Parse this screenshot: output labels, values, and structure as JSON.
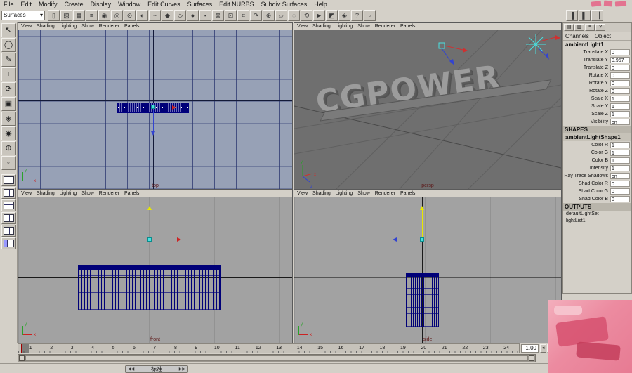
{
  "menubar": {
    "items": [
      "File",
      "Edit",
      "Modify",
      "Create",
      "Display",
      "Window",
      "Edit Curves",
      "Surfaces",
      "Edit NURBS",
      "Subdiv Surfaces",
      "Help"
    ]
  },
  "shelf": {
    "mode_selector": "Surfaces",
    "dropdown_glyph": "▾",
    "icons": [
      {
        "name": "new-scene-icon",
        "glyph": "▯"
      },
      {
        "name": "open-scene-icon",
        "glyph": "▨"
      },
      {
        "name": "save-scene-icon",
        "glyph": "▦"
      },
      {
        "name": "select-hierarchy-icon",
        "glyph": "≡"
      },
      {
        "name": "select-object-icon",
        "glyph": "◉"
      },
      {
        "name": "select-component-icon",
        "glyph": "◎"
      },
      {
        "name": "mask-handles-icon",
        "glyph": "⊙"
      },
      {
        "name": "mask-joints-icon",
        "glyph": "◐"
      },
      {
        "name": "mask-curves-icon",
        "glyph": "~"
      },
      {
        "name": "mask-surfaces-icon",
        "glyph": "◆"
      },
      {
        "name": "mask-deformations-icon",
        "glyph": "◇"
      },
      {
        "name": "mask-rendering-icon",
        "glyph": "●"
      },
      {
        "name": "mask-misc-icon",
        "glyph": "▪"
      },
      {
        "name": "lock-selection-icon",
        "glyph": "⊠"
      },
      {
        "name": "highlight-selection-icon",
        "glyph": "⊡"
      },
      {
        "name": "snap-grid-icon",
        "glyph": "⌗"
      },
      {
        "name": "snap-curve-icon",
        "glyph": "↷"
      },
      {
        "name": "snap-point-icon",
        "glyph": "⊕"
      },
      {
        "name": "snap-plane-icon",
        "glyph": "▱"
      },
      {
        "name": "make-live-icon",
        "glyph": "◌"
      },
      {
        "name": "construction-history-icon",
        "glyph": "⟲"
      },
      {
        "name": "render-frame-icon",
        "glyph": "►"
      },
      {
        "name": "ipr-render-icon",
        "glyph": "◩"
      },
      {
        "name": "render-globals-icon",
        "glyph": "◈"
      },
      {
        "name": "quick-help-icon",
        "glyph": "?"
      },
      {
        "name": "field-entry-icon",
        "glyph": "▫"
      }
    ],
    "right_icons": [
      {
        "name": "toggle-attribute-editor-icon",
        "glyph": "▐"
      },
      {
        "name": "toggle-tool-settings-icon",
        "glyph": "▌"
      },
      {
        "name": "toggle-channel-box-icon",
        "glyph": "▕"
      }
    ]
  },
  "toolbox": {
    "tools": [
      {
        "name": "select-tool",
        "glyph": "↖"
      },
      {
        "name": "lasso-tool",
        "glyph": "◯"
      },
      {
        "name": "paint-select-tool",
        "glyph": "✎"
      },
      {
        "name": "move-tool",
        "glyph": "+"
      },
      {
        "name": "rotate-tool",
        "glyph": "⟳"
      },
      {
        "name": "scale-tool",
        "glyph": "▣"
      },
      {
        "name": "manip-tool",
        "glyph": "◈"
      },
      {
        "name": "soft-mod-tool",
        "glyph": "◉"
      },
      {
        "name": "show-manip-tool",
        "glyph": "⊕"
      },
      {
        "name": "last-tool",
        "glyph": "◦"
      }
    ]
  },
  "viewport_menu": [
    "View",
    "Shading",
    "Lighting",
    "Show",
    "Renderer",
    "Panels"
  ],
  "viewports": {
    "top": {
      "label": "top"
    },
    "persp": {
      "label": "persp",
      "object_text": "CGPOWER"
    },
    "front": {
      "label": "front"
    },
    "side": {
      "label": "side"
    }
  },
  "axis": {
    "x": "x",
    "y": "y",
    "z": "z"
  },
  "channel_box": {
    "toolbar_icons": [
      {
        "name": "channel-box-tab-icon",
        "glyph": "▤"
      },
      {
        "name": "layer-editor-tab-icon",
        "glyph": "▥"
      },
      {
        "name": "channel-slider-icon",
        "glyph": "≡"
      },
      {
        "name": "channel-options-icon",
        "glyph": "?"
      }
    ],
    "menus": [
      "Channels",
      "Object"
    ],
    "node": "ambientLight1",
    "transform_rows": [
      {
        "label": "Translate X",
        "value": "0"
      },
      {
        "label": "Translate Y",
        "value": "0.957"
      },
      {
        "label": "Translate Z",
        "value": "0"
      },
      {
        "label": "Rotate X",
        "value": "0"
      },
      {
        "label": "Rotate Y",
        "value": "0"
      },
      {
        "label": "Rotate Z",
        "value": "0"
      },
      {
        "label": "Scale X",
        "value": "1"
      },
      {
        "label": "Scale Y",
        "value": "1"
      },
      {
        "label": "Scale Z",
        "value": "1"
      },
      {
        "label": "Visibility",
        "value": "on"
      }
    ],
    "shapes_header": "SHAPES",
    "shape_node": "ambientLightShape1",
    "shape_rows": [
      {
        "label": "Color R",
        "value": "1"
      },
      {
        "label": "Color G",
        "value": "1"
      },
      {
        "label": "Color B",
        "value": "1"
      },
      {
        "label": "Intensity",
        "value": "1"
      },
      {
        "label": "Ray Trace Shadows",
        "value": "on"
      },
      {
        "label": "Shad Color R",
        "value": "0"
      },
      {
        "label": "Shad Color G",
        "value": "0"
      },
      {
        "label": "Shad Color B",
        "value": "0"
      }
    ],
    "outputs_header": "OUTPUTS",
    "outputs": [
      "defaultLightSet",
      "lightList1"
    ]
  },
  "timeline": {
    "frames": [
      "1",
      "2",
      "3",
      "4",
      "5",
      "6",
      "7",
      "8",
      "9",
      "10",
      "11",
      "12",
      "13",
      "14",
      "15",
      "16",
      "17",
      "18",
      "19",
      "20",
      "21",
      "22",
      "23",
      "24"
    ],
    "current_frame_field": "1.00",
    "buttons": [
      {
        "name": "play-backwards-button",
        "glyph": "◄"
      },
      {
        "name": "play-forward-button",
        "glyph": "►"
      }
    ]
  },
  "player_overlay": {
    "prev": "◀◀",
    "label": "标准",
    "next": "▶▶"
  },
  "colors": {
    "wireframe": "#000080",
    "manip_x": "#cc2222",
    "manip_y": "#e8e800",
    "manip_z": "#3344d0",
    "light_gizmo": "#49e0e0",
    "watermark_pink": "#ec8ba0"
  }
}
